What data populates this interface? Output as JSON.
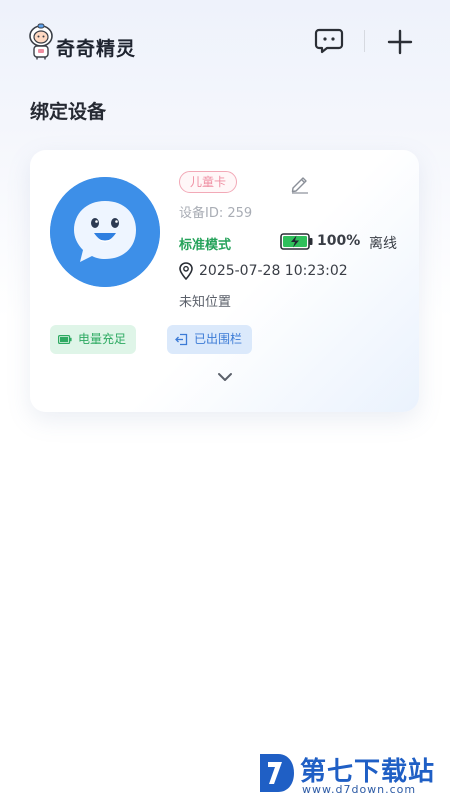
{
  "header": {
    "app_title": "奇奇精灵",
    "logo_icon": "astronaut-mascot-icon",
    "message_icon": "chat-bubble-icon",
    "add_icon": "plus-icon"
  },
  "section_title": "绑定设备",
  "device": {
    "avatar_icon": "smiling-chat-bubble-avatar",
    "tag": "儿童卡",
    "device_id": "设备ID: 259",
    "mode": "标准模式",
    "battery_percent": "100%",
    "battery_level": 1.0,
    "status": "离线",
    "timestamp": "2025-07-28 10:23:02",
    "location": "未知位置",
    "chips": {
      "battery_status": "电量充足",
      "fence_status": "已出围栏"
    }
  },
  "colors": {
    "accent_blue": "#3d8fe8",
    "mode_green": "#26a35b",
    "tag_pink": "#ef8ea2",
    "chip_green_bg": "#dff5e8",
    "chip_blue_bg": "#dbe9fb"
  },
  "watermark": {
    "name": "第七下载站",
    "url": "www.d7down.com"
  }
}
